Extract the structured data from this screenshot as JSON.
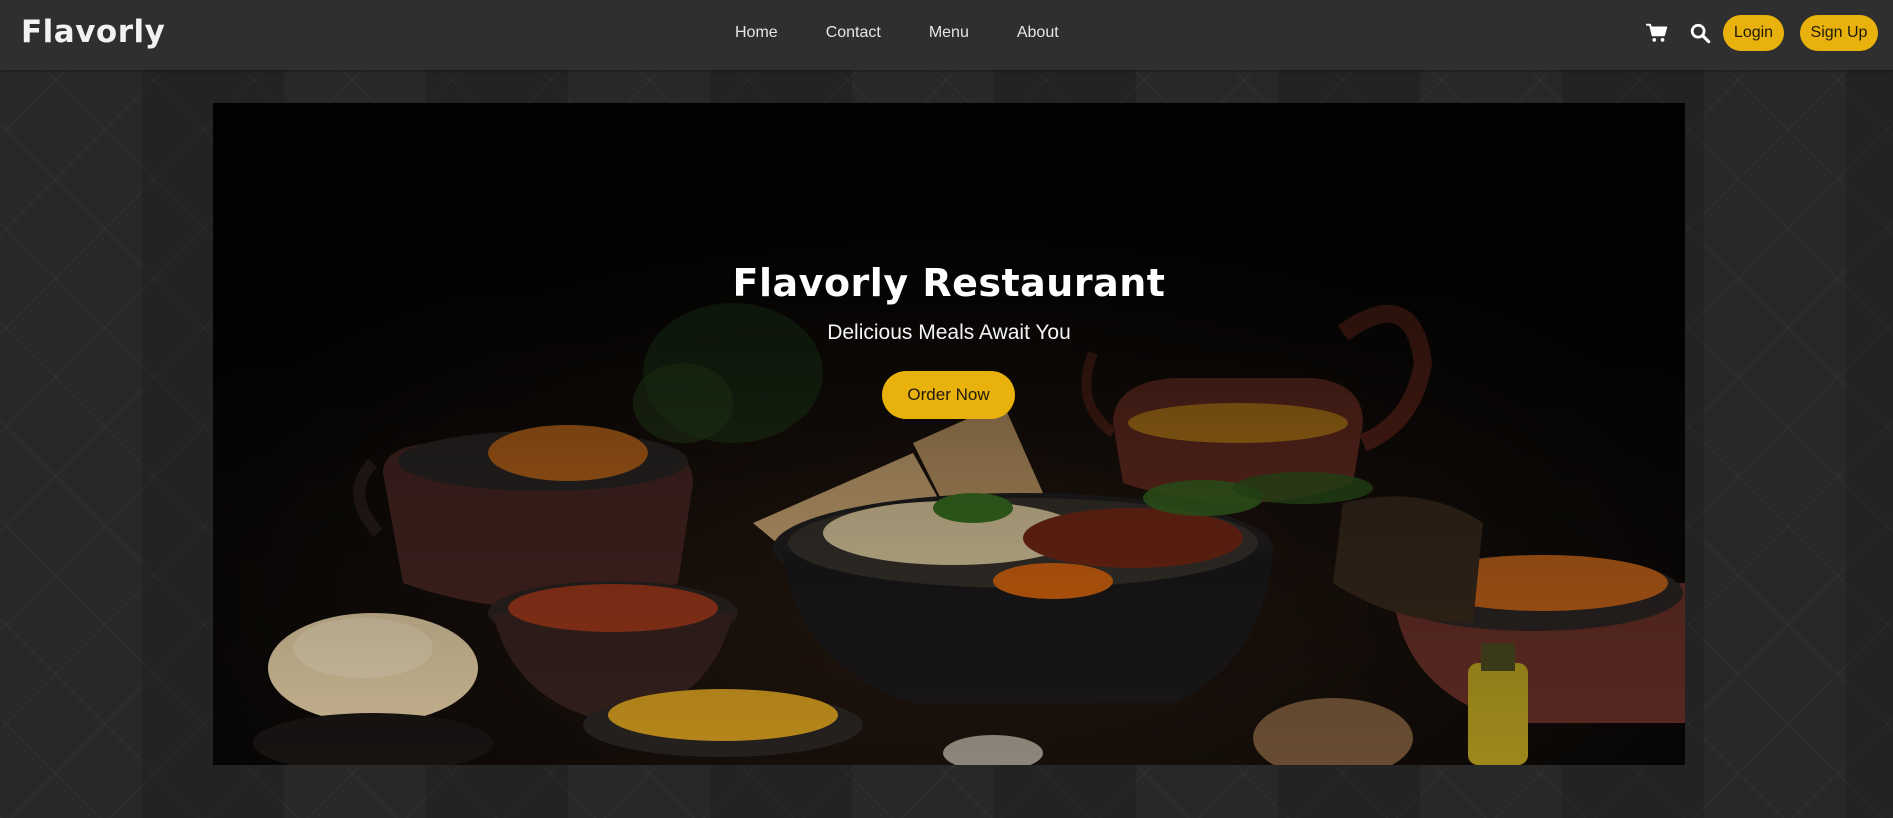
{
  "brand": {
    "logo_text": "Flavorly"
  },
  "nav": {
    "links": [
      {
        "label": "Home"
      },
      {
        "label": "Contact"
      },
      {
        "label": "Menu"
      },
      {
        "label": "About"
      }
    ]
  },
  "header_actions": {
    "cart_icon": "shopping-cart-icon",
    "search_icon": "search-icon",
    "login_label": "Login",
    "signup_label": "Sign Up"
  },
  "hero": {
    "title": "Flavorly Restaurant",
    "subtitle": "Delicious Meals Await You",
    "cta_label": "Order Now",
    "image_description": "Indian dishes on dark table"
  },
  "colors": {
    "accent": "#e9b10c",
    "navbar": "#2f2f30",
    "background": "#282829",
    "text_light": "#ffffff"
  }
}
